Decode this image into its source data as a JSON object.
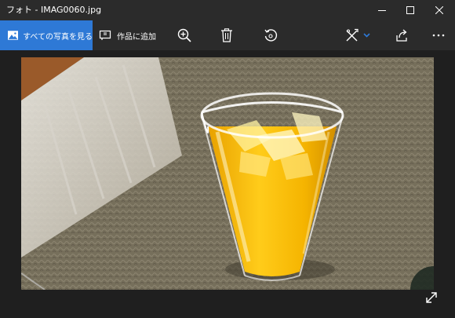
{
  "window": {
    "title": "フォト - IMAG0060.jpg"
  },
  "titlebar_buttons": {
    "minimize": "minimize-icon",
    "maximize": "maximize-icon",
    "close": "close-icon"
  },
  "toolbar": {
    "all_photos_label": "すべての写真を見る",
    "add_to_creation_label": "作品に追加",
    "icons": [
      "zoom-in-icon",
      "delete-icon",
      "rotate-icon",
      "edit-create-icon",
      "share-icon",
      "more-icon"
    ]
  },
  "colors": {
    "accent": "#2e79d6",
    "chrome": "#2b2b2b",
    "background": "#1f1f1f"
  },
  "photo": {
    "description_icon": "photo-image"
  }
}
